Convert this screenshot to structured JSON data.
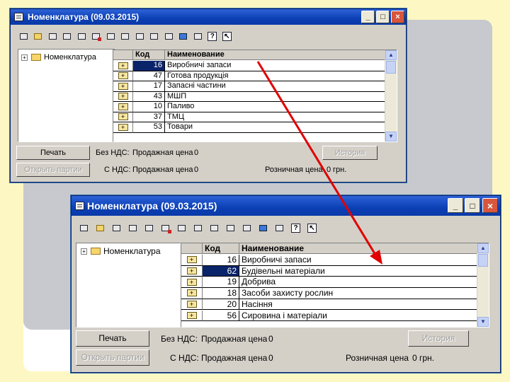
{
  "window": {
    "title": "Номенклатура (09.03.2015)",
    "controls": {
      "minimize": "_",
      "maximize": "□",
      "close": "×"
    }
  },
  "tree": {
    "root_label": "Номенклатура",
    "expander": "+"
  },
  "grid": {
    "columns": [
      "Код",
      "Наименование"
    ],
    "row_icon": "+"
  },
  "window1_rows": [
    {
      "code": "16",
      "name": "Виробничі запаси"
    },
    {
      "code": "47",
      "name": "Готова продукція"
    },
    {
      "code": "17",
      "name": "Запасні частини"
    },
    {
      "code": "43",
      "name": "МШП"
    },
    {
      "code": "10",
      "name": "Паливо"
    },
    {
      "code": "37",
      "name": "ТМЦ"
    },
    {
      "code": "53",
      "name": "Товари"
    }
  ],
  "window2_rows": [
    {
      "code": "16",
      "name": "Виробничі запаси"
    },
    {
      "code": "62",
      "name": "Будівельні матеріали"
    },
    {
      "code": "19",
      "name": "Добрива"
    },
    {
      "code": "18",
      "name": "Засоби захисту рослин"
    },
    {
      "code": "20",
      "name": "Насіння"
    },
    {
      "code": "56",
      "name": "Сировина і матеріали"
    }
  ],
  "footer": {
    "print_button": "Печать",
    "open_batches_button": "Открыть партии",
    "history_button": "История",
    "without_vat_label": "Без НДС:",
    "with_vat_label": "С НДС:",
    "sale_price_label": "Продажная цена",
    "sale_price_value": "0",
    "retail_price_label": "Розничная цена",
    "retail_price_value": "0",
    "currency": "грн."
  },
  "colors": {
    "titlebar": "#0b3fb4",
    "window_face": "#d4d0c8",
    "selection": "#0a246a",
    "arrow": "#e00000",
    "slide_background": "#fdf7c3"
  },
  "icons": [
    "new-icon",
    "folder-icon",
    "grid-icon",
    "find-icon",
    "add-icon",
    "delete-icon",
    "move-icon",
    "link-icon",
    "copy-icon",
    "paste-icon",
    "print-icon",
    "tree-icon",
    "monitor-icon",
    "help-icon",
    "what-is-icon"
  ]
}
